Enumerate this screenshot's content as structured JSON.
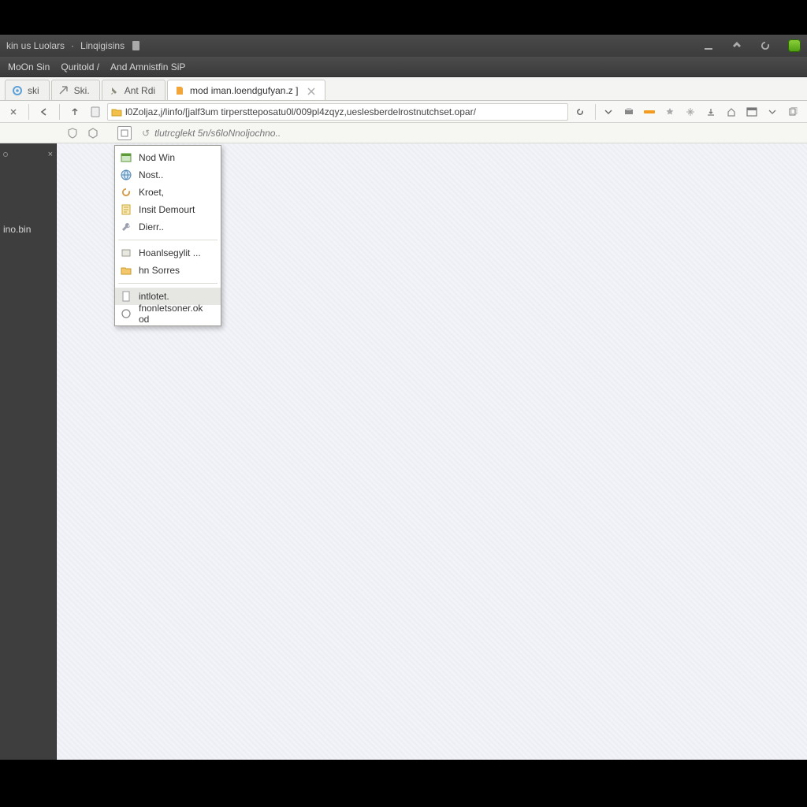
{
  "colors": {
    "accent_orange": "#f29b1d",
    "accent_green": "#6cbf1f"
  },
  "titlebar": {
    "app_name": "kin us Luolars",
    "doc_name": "Linqigisins"
  },
  "menubar": {
    "items": [
      "MoOn Sin",
      "Quritold /",
      "And Amnistfin SiP"
    ]
  },
  "tabs": [
    {
      "label": "ski"
    },
    {
      "label": "Ski."
    },
    {
      "label": "Ant Rdi"
    },
    {
      "label": "mod iman.loendgufyan.z ]",
      "active": true
    }
  ],
  "navbar": {
    "url": "l0Zoljaz,j/linfo/[jalf3um tirperstteposatu0l/009pl4zqyz,ueslesberdelrostnutchset.opar/"
  },
  "searchbar": {
    "placeholder": "tlutrcglekt 5n/s6loNnoljochno.."
  },
  "sidebar": {
    "item_label": "ino.bin"
  },
  "context_menu": {
    "items": [
      {
        "label": "Nod Win",
        "icon": "window"
      },
      {
        "label": "Nost..",
        "icon": "globe"
      },
      {
        "label": "Kroet,",
        "icon": "refresh"
      },
      {
        "label": "Insit Demourt",
        "icon": "note"
      },
      {
        "label": "Dierr..",
        "icon": "tool"
      }
    ],
    "items2": [
      {
        "label": "Hoanlsegylit ...",
        "icon": "box"
      },
      {
        "label": "hn Sorres",
        "icon": "folder"
      }
    ],
    "items3": [
      {
        "label": "intlotet.",
        "icon": "doc",
        "highlight": true
      },
      {
        "label": "fnonletsoner.ok od",
        "icon": "circle"
      }
    ]
  }
}
